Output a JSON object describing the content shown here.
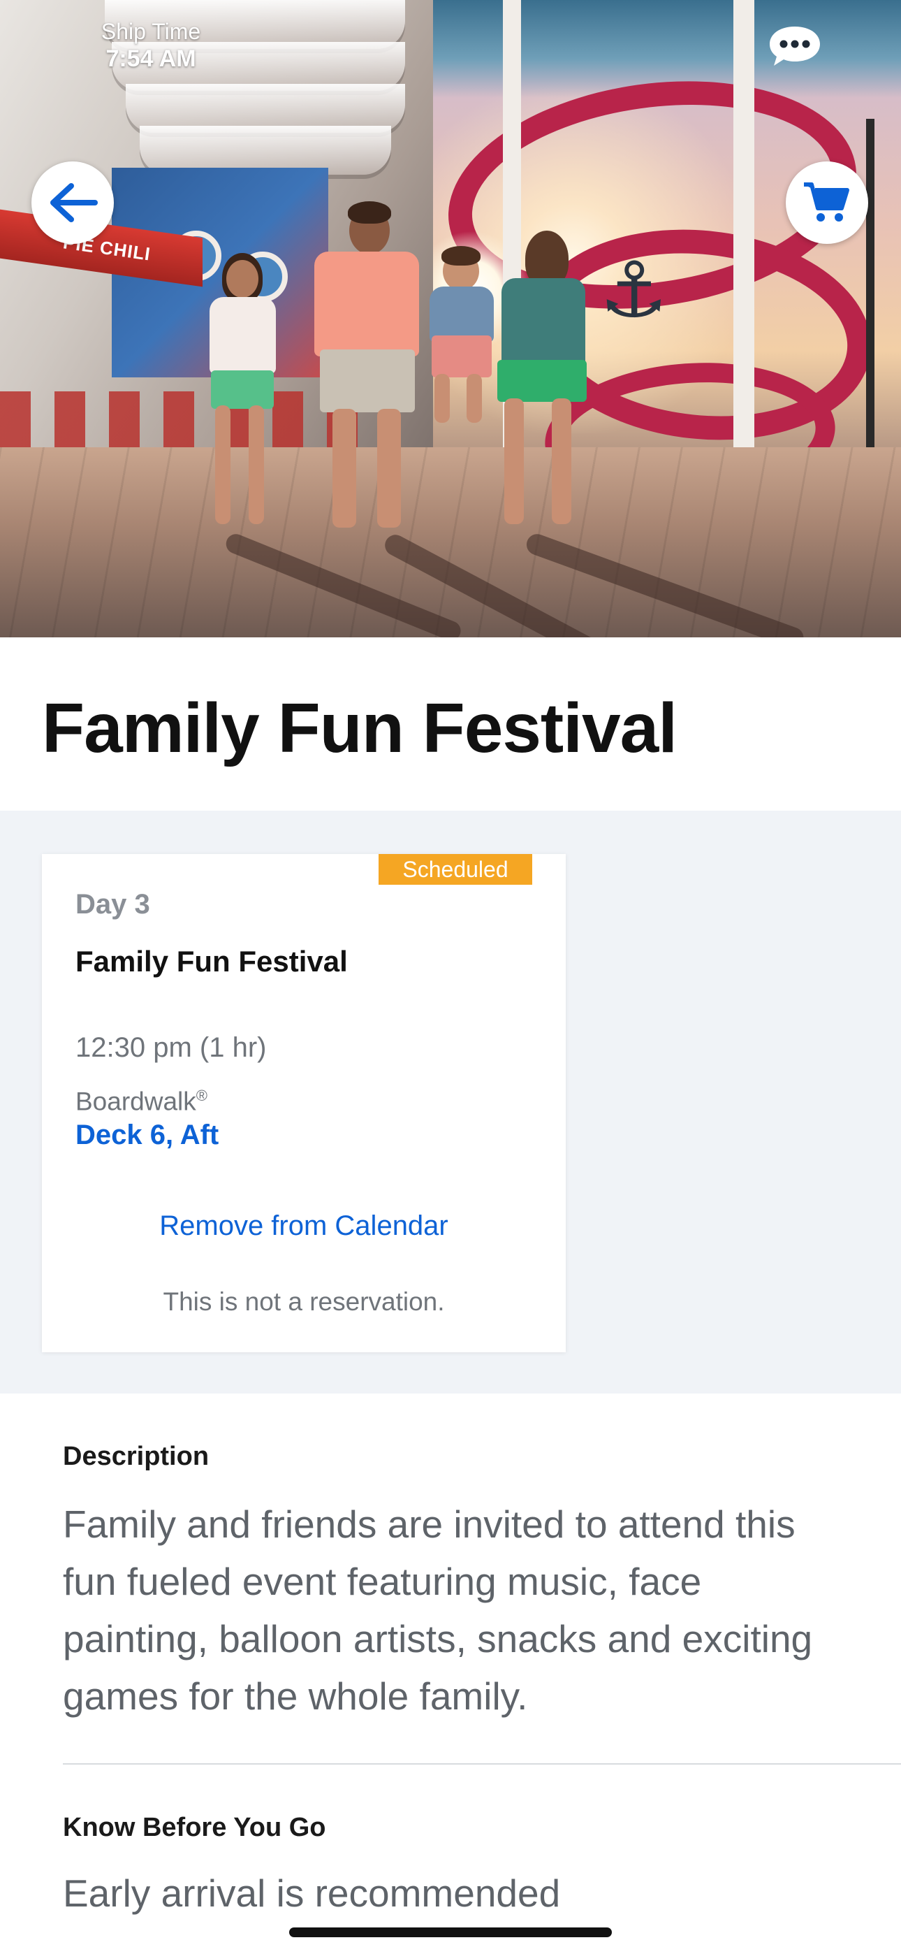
{
  "status": {
    "ship_time_label": "Ship Time",
    "ship_time_value": "7:54 AM"
  },
  "header": {
    "back_icon": "arrow-left-icon",
    "cart_icon": "shopping-cart-icon",
    "chat_icon": "chat-bubble-icon",
    "accent_color": "#0d62d6"
  },
  "hero": {
    "sign_text": "PIE CHILI"
  },
  "page": {
    "title": "Family Fun Festival"
  },
  "event_card": {
    "badge": "Scheduled",
    "badge_color": "#f5a623",
    "day": "Day 3",
    "title": "Family Fun Festival",
    "time": "12:30 pm (1 hr)",
    "venue": "Boardwalk",
    "venue_mark": "®",
    "deck": "Deck 6, Aft",
    "remove_label": "Remove from Calendar",
    "note": "This is not a reservation."
  },
  "description": {
    "heading": "Description",
    "body": "Family and friends are invited to attend this fun fueled event featuring music, face painting, balloon artists, snacks and exciting games for the whole family."
  },
  "know_before_you_go": {
    "heading": "Know Before You Go",
    "body": "Early arrival is recommended"
  }
}
